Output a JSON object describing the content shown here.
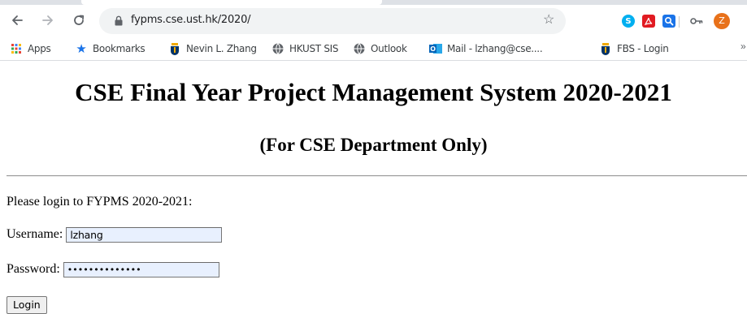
{
  "browser": {
    "url": "fypms.cse.ust.hk/2020/",
    "profile_initial": "Z",
    "icons": {
      "back": "arrow-left-icon",
      "forward": "arrow-right-icon",
      "reload": "reload-icon",
      "lock": "lock-icon",
      "bookmark_star": "star-icon",
      "skype": "skype-icon",
      "pdf": "pdf-icon",
      "search_ext": "search-extension-icon",
      "key": "key-icon"
    }
  },
  "bookmarks": [
    {
      "label": "Apps",
      "icon": "apps-grid-icon"
    },
    {
      "label": "Bookmarks",
      "icon": "star-icon"
    },
    {
      "label": "Nevin L. Zhang",
      "icon": "hkust-icon"
    },
    {
      "label": "HKUST SIS",
      "icon": "globe-icon"
    },
    {
      "label": "Outlook",
      "icon": "globe-icon"
    },
    {
      "label": "Mail - lzhang@cse....",
      "icon": "outlook-icon"
    },
    {
      "label": "FBS - Login",
      "icon": "hkust-icon"
    }
  ],
  "page": {
    "title": "CSE Final Year Project Management System 2020-2021",
    "subtitle": "(For CSE Department Only)",
    "intro": "Please login to FYPMS 2020-2021:",
    "username_label": "Username:",
    "username_value": "lzhang",
    "password_label": "Password:",
    "password_value": "••••••••••••••",
    "login_button": "Login"
  },
  "colors": {
    "autofill_bg": "#e8f0fe",
    "chrome_blue": "#1a73e8",
    "profile_orange": "#e8711a"
  }
}
